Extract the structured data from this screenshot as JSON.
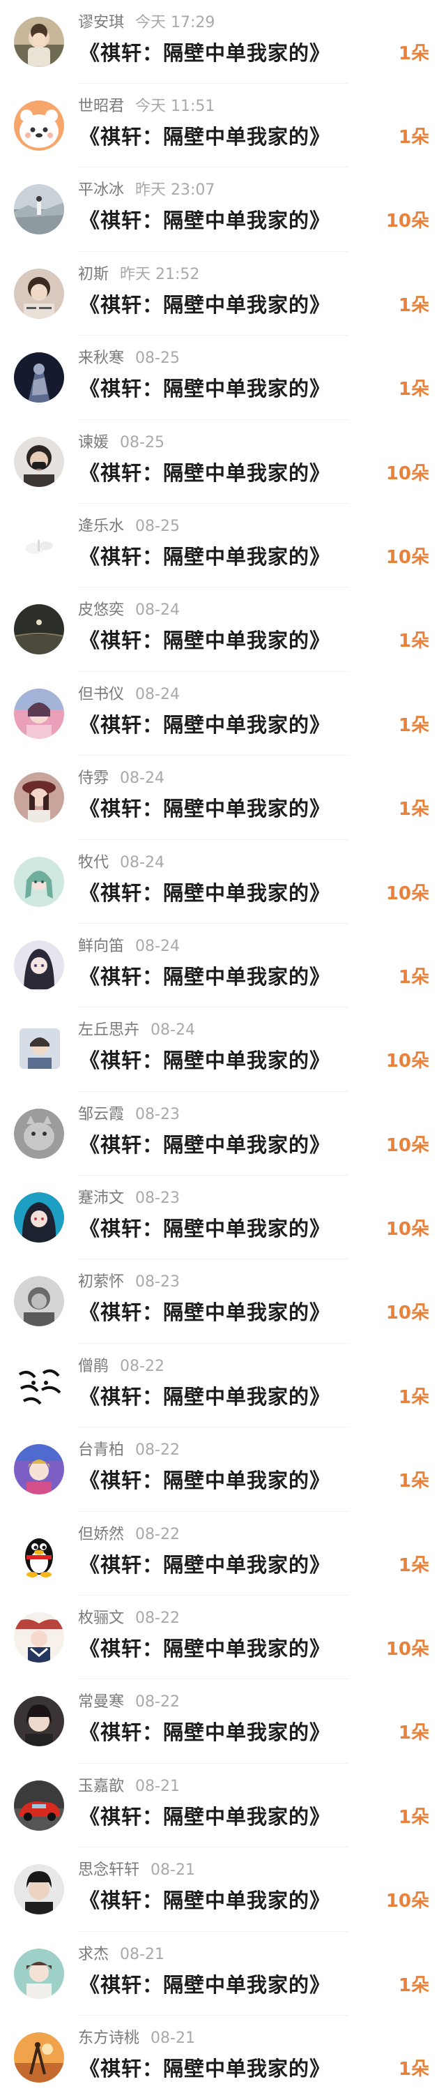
{
  "colors": {
    "accent": "#e8813a",
    "name_text": "#7a7a7a",
    "time_text": "#a9a9a9",
    "title_text": "#1c1c1c"
  },
  "entries": [
    {
      "name": "谬安琪",
      "time": "今天 17:29",
      "title": "《祺轩：隔壁中单我家的》",
      "amount": "1朵",
      "avatar": "avatar-child-photo"
    },
    {
      "name": "世昭君",
      "time": "今天 11:51",
      "title": "《祺轩：隔壁中单我家的》",
      "amount": "1朵",
      "avatar": "avatar-cartoon-bear"
    },
    {
      "name": "平冰冰",
      "time": "昨天 23:07",
      "title": "《祺轩：隔壁中单我家的》",
      "amount": "10朵",
      "avatar": "avatar-landscape-person"
    },
    {
      "name": "初斯",
      "time": "昨天 21:52",
      "title": "《祺轩：隔壁中单我家的》",
      "amount": "1朵",
      "avatar": "avatar-portrait-text"
    },
    {
      "name": "来秋寒",
      "time": "08-25",
      "title": "《祺轩：隔壁中单我家的》",
      "amount": "1朵",
      "avatar": "avatar-dark-figure"
    },
    {
      "name": "谏媛",
      "time": "08-25",
      "title": "《祺轩：隔壁中单我家的》",
      "amount": "10朵",
      "avatar": "avatar-masked-person"
    },
    {
      "name": "逄乐水",
      "time": "08-25",
      "title": "《祺轩：隔壁中单我家的》",
      "amount": "10朵",
      "avatar": "avatar-white-blur"
    },
    {
      "name": "皮悠奕",
      "time": "08-24",
      "title": "《祺轩：隔壁中单我家的》",
      "amount": "1朵",
      "avatar": "avatar-night-moon"
    },
    {
      "name": "但书仪",
      "time": "08-24",
      "title": "《祺轩：隔壁中单我家的》",
      "amount": "1朵",
      "avatar": "avatar-pink-anime"
    },
    {
      "name": "侍雰",
      "time": "08-24",
      "title": "《祺轩：隔壁中单我家的》",
      "amount": "1朵",
      "avatar": "avatar-girl-hat"
    },
    {
      "name": "牧代",
      "time": "08-24",
      "title": "《祺轩：隔壁中单我家的》",
      "amount": "10朵",
      "avatar": "avatar-green-anime"
    },
    {
      "name": "鲜向笛",
      "time": "08-24",
      "title": "《祺轩：隔壁中单我家的》",
      "amount": "1朵",
      "avatar": "avatar-dark-hair-anime"
    },
    {
      "name": "左丘思卉",
      "time": "08-24",
      "title": "《祺轩：隔壁中单我家的》",
      "amount": "10朵",
      "avatar": "avatar-boy-portrait"
    },
    {
      "name": "邹云霞",
      "time": "08-23",
      "title": "《祺轩：隔壁中单我家的》",
      "amount": "10朵",
      "avatar": "avatar-cat-grey"
    },
    {
      "name": "蹇沛文",
      "time": "08-23",
      "title": "《祺轩：隔壁中单我家的》",
      "amount": "10朵",
      "avatar": "avatar-blue-anime"
    },
    {
      "name": "初萦怀",
      "time": "08-23",
      "title": "《祺轩：隔壁中单我家的》",
      "amount": "10朵",
      "avatar": "avatar-grey-photo"
    },
    {
      "name": "僧鹃",
      "time": "08-22",
      "title": "《祺轩：隔壁中单我家的》",
      "amount": "1朵",
      "avatar": "avatar-tiger-sketch"
    },
    {
      "name": "台青柏",
      "time": "08-22",
      "title": "《祺轩：隔壁中单我家的》",
      "amount": "1朵",
      "avatar": "avatar-purple-anime"
    },
    {
      "name": "但娇然",
      "time": "08-22",
      "title": "《祺轩：隔壁中单我家的》",
      "amount": "1朵",
      "avatar": "avatar-qq-penguin"
    },
    {
      "name": "枚骊文",
      "time": "08-22",
      "title": "《祺轩：隔壁中单我家的》",
      "amount": "10朵",
      "avatar": "avatar-sailor-illustration"
    },
    {
      "name": "常曼寒",
      "time": "08-22",
      "title": "《祺轩：隔壁中单我家的》",
      "amount": "1朵",
      "avatar": "avatar-short-hair-girl"
    },
    {
      "name": "玉嘉歆",
      "time": "08-21",
      "title": "《祺轩：隔壁中单我家的》",
      "amount": "1朵",
      "avatar": "avatar-red-car"
    },
    {
      "name": "思念轩轩",
      "time": "08-21",
      "title": "《祺轩：隔壁中单我家的》",
      "amount": "10朵",
      "avatar": "avatar-young-man"
    },
    {
      "name": "求杰",
      "time": "08-21",
      "title": "《祺轩：隔壁中单我家的》",
      "amount": "1朵",
      "avatar": "avatar-teal-girl"
    },
    {
      "name": "东方诗桃",
      "time": "08-21",
      "title": "《祺轩：隔壁中单我家的》",
      "amount": "1朵",
      "avatar": "avatar-sunset-dancer"
    }
  ]
}
